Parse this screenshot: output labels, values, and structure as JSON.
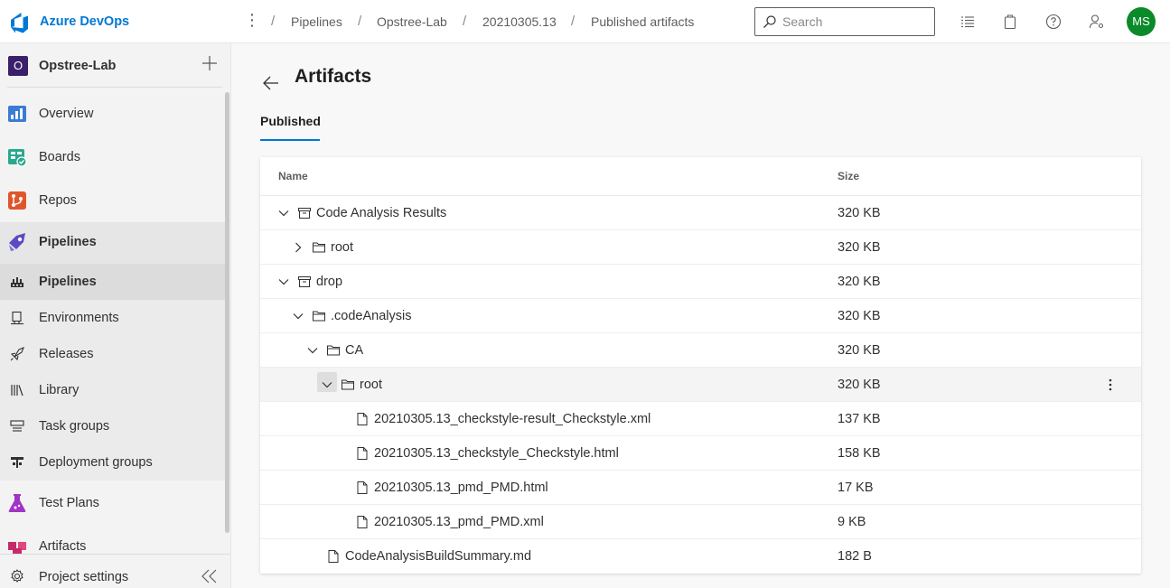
{
  "app": {
    "brand": "Azure DevOps"
  },
  "breadcrumb": [
    "Pipelines",
    "Opstree-Lab",
    "20210305.13",
    "Published artifacts"
  ],
  "search": {
    "placeholder": "Search"
  },
  "user": {
    "initials": "MS",
    "avatar_color": "#0b8a2a"
  },
  "project": {
    "initial": "O",
    "name": "Opstree-Lab"
  },
  "sidebar": {
    "items": [
      {
        "label": "Overview",
        "icon": "overview-icon"
      },
      {
        "label": "Boards",
        "icon": "boards-icon"
      },
      {
        "label": "Repos",
        "icon": "repos-icon"
      },
      {
        "label": "Pipelines",
        "icon": "pipelines-icon"
      }
    ],
    "pipelines_sub": [
      {
        "label": "Pipelines",
        "icon": "pipelines-sub-icon"
      },
      {
        "label": "Environments",
        "icon": "environments-icon"
      },
      {
        "label": "Releases",
        "icon": "rocket-icon"
      },
      {
        "label": "Library",
        "icon": "library-icon"
      },
      {
        "label": "Task groups",
        "icon": "task-groups-icon"
      },
      {
        "label": "Deployment groups",
        "icon": "deployment-groups-icon"
      }
    ],
    "after": [
      {
        "label": "Test Plans",
        "icon": "test-plans-icon"
      },
      {
        "label": "Artifacts",
        "icon": "artifacts-icon"
      }
    ],
    "settings_label": "Project settings"
  },
  "page": {
    "title": "Artifacts",
    "tab": "Published"
  },
  "table": {
    "columns": [
      "Name",
      "Size"
    ],
    "rows": [
      {
        "name": "Code Analysis Results",
        "size": "320 KB",
        "type": "artifact",
        "expanded": true,
        "depth": 0
      },
      {
        "name": "root",
        "size": "320 KB",
        "type": "folder",
        "expanded": false,
        "depth": 1
      },
      {
        "name": "drop",
        "size": "320 KB",
        "type": "artifact",
        "expanded": true,
        "depth": 0
      },
      {
        "name": ".codeAnalysis",
        "size": "320 KB",
        "type": "folder",
        "expanded": true,
        "depth": 1
      },
      {
        "name": "CA",
        "size": "320 KB",
        "type": "folder",
        "expanded": true,
        "depth": 2
      },
      {
        "name": "root",
        "size": "320 KB",
        "type": "folder",
        "expanded": true,
        "depth": 3,
        "hover": true
      },
      {
        "name": "20210305.13_checkstyle-result_Checkstyle.xml",
        "size": "137 KB",
        "type": "file",
        "depth": 4
      },
      {
        "name": "20210305.13_checkstyle_Checkstyle.html",
        "size": "158 KB",
        "type": "file",
        "depth": 4
      },
      {
        "name": "20210305.13_pmd_PMD.html",
        "size": "17 KB",
        "type": "file",
        "depth": 4
      },
      {
        "name": "20210305.13_pmd_PMD.xml",
        "size": "9 KB",
        "type": "file",
        "depth": 4
      },
      {
        "name": "CodeAnalysisBuildSummary.md",
        "size": "182 B",
        "type": "file",
        "depth": 2
      }
    ]
  }
}
